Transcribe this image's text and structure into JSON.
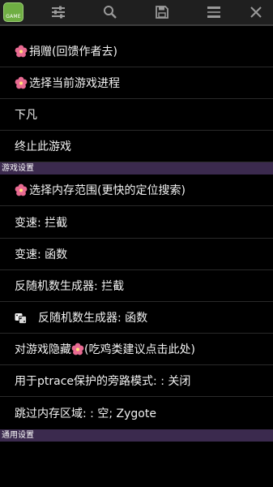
{
  "toolbar": {
    "logo_text": "GAME",
    "icons": [
      "sliders-icon",
      "search-icon",
      "save-icon",
      "list-icon",
      "close-icon"
    ],
    "icon_color": "#9a9a9a"
  },
  "items_top": [
    {
      "label": "捐赠(回馈作者去)",
      "icon": "flower-icon"
    },
    {
      "label": "选择当前游戏进程",
      "icon": "flower-icon"
    },
    {
      "label": "下凡"
    },
    {
      "label": "终止此游戏"
    }
  ],
  "section_game": "游戏设置",
  "items_game": [
    {
      "label": "选择内存范围(更快的定位搜索)",
      "icon": "flower-icon"
    },
    {
      "label": "变速: 拦截"
    },
    {
      "label": "变速: 函数"
    },
    {
      "label": "反随机数生成器: 拦截"
    },
    {
      "label": "反随机数生成器: 函数",
      "icon": "dice-icon"
    },
    {
      "label_pre": "对游戏隐藏",
      "label_post": "(吃鸡类建议点击此处)",
      "icon": "flower-icon"
    },
    {
      "label": "用于ptrace保护的旁路模式: : 关闭"
    },
    {
      "label": "跳过内存区域: : 空; Zygote"
    }
  ],
  "section_general": "通用设置",
  "colors": {
    "section_bg": "#3b2a4e",
    "accent": "#6fae43",
    "flower": "#e86a92"
  }
}
